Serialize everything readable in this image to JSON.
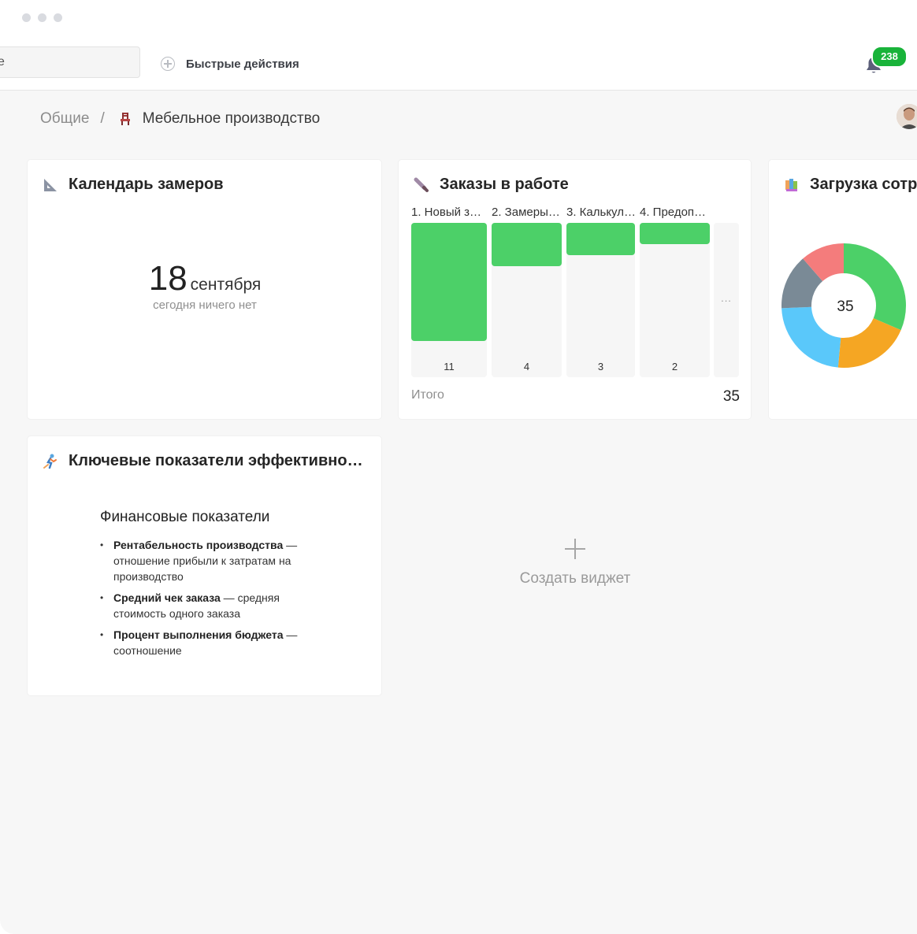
{
  "window": {
    "dots": 3
  },
  "topbar": {
    "search_value": "е",
    "quick_actions_label": "Быстрые действия",
    "notifications_count": "238"
  },
  "breadcrumb": {
    "root": "Общие",
    "separator": "/",
    "current": "Мебельное производство"
  },
  "widgets": {
    "calendar": {
      "title": "Календарь замеров",
      "day": "18",
      "month": "сентября",
      "empty_text": "сегодня ничего нет"
    },
    "orders": {
      "title": "Заказы в работе",
      "total_label": "Итого",
      "total_value": "35",
      "more_label": "..."
    },
    "workload": {
      "title": "Загрузка сотр",
      "center_value": "35"
    },
    "kpi": {
      "title": "Ключевые показатели эффективно…",
      "section_heading": "Финансовые показатели",
      "items": [
        {
          "term": "Рентабельность производства",
          "desc": " — отношение прибыли к затратам на производство"
        },
        {
          "term": "Средний чек заказа",
          "desc": " — средняя стоимость одного заказа"
        },
        {
          "term": "Процент выполнения бюджета",
          "desc": " — соотношение"
        }
      ]
    },
    "create": {
      "label": "Создать виджет"
    }
  },
  "colors": {
    "bar_green": "#4cd068",
    "badge_green": "#19b33a",
    "donut": [
      "#4cd068",
      "#f5a623",
      "#5ac8fa",
      "#7a8a96",
      "#f47c7c"
    ]
  },
  "chart_data": [
    {
      "type": "bar",
      "title": "Заказы в работе",
      "categories": [
        "1. Новый з…",
        "2. Замеры…",
        "3. Калькул…",
        "4. Предоп…"
      ],
      "values": [
        11,
        4,
        3,
        2
      ],
      "ylim": [
        0,
        11
      ]
    },
    {
      "type": "pie",
      "title": "Загрузка сотр",
      "center_value": 35,
      "values": [
        11,
        7,
        8,
        5,
        4
      ],
      "colors": [
        "#4cd068",
        "#f5a623",
        "#5ac8fa",
        "#7a8a96",
        "#f47c7c"
      ]
    }
  ]
}
